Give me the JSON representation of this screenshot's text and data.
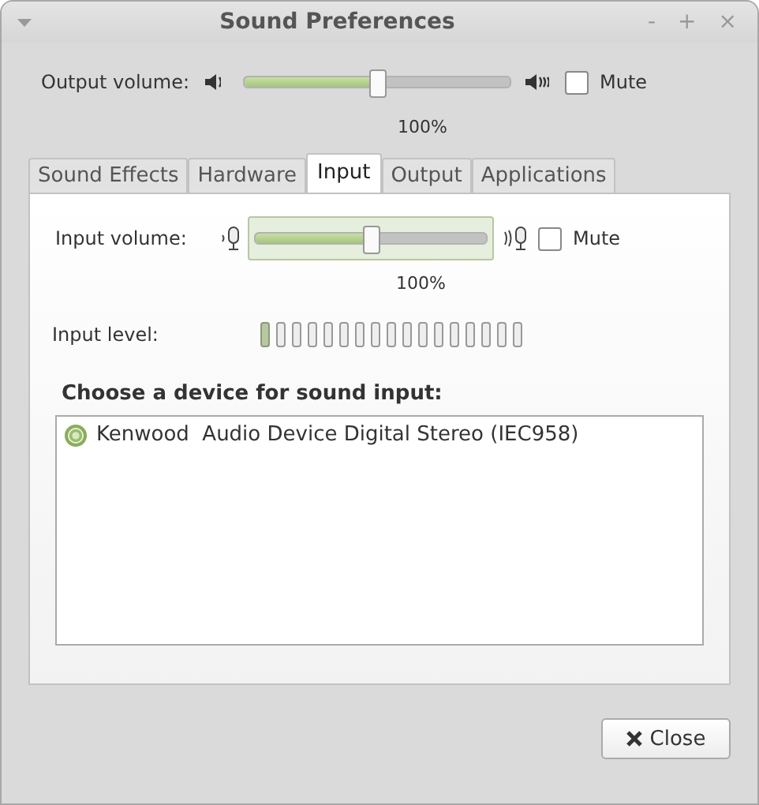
{
  "window": {
    "title": "Sound Preferences",
    "buttons": [
      "-",
      "+",
      "×"
    ]
  },
  "output": {
    "label": "Output volume:",
    "level": 0.5,
    "reading": "100%",
    "mute": {
      "label": "Mute",
      "checked": false
    }
  },
  "tabs": [
    {
      "label": "Sound Effects",
      "selected": false
    },
    {
      "label": "Hardware",
      "selected": false
    },
    {
      "label": "Input",
      "selected": true
    },
    {
      "label": "Output",
      "selected": false
    },
    {
      "label": "Applications",
      "selected": false
    }
  ],
  "input": {
    "label": "Input volume:",
    "level": 0.5,
    "reading": "100%",
    "mute": {
      "label": "Mute",
      "checked": false
    }
  },
  "input_level": {
    "label": "Input level:",
    "level": 0.06
  },
  "devices": {
    "heading": "Choose a device for sound input:",
    "items": [
      {
        "label": "Kenwood  Audio Device Digital Stereo (IEC958)",
        "selected": true
      }
    ]
  },
  "close_button": "Close"
}
